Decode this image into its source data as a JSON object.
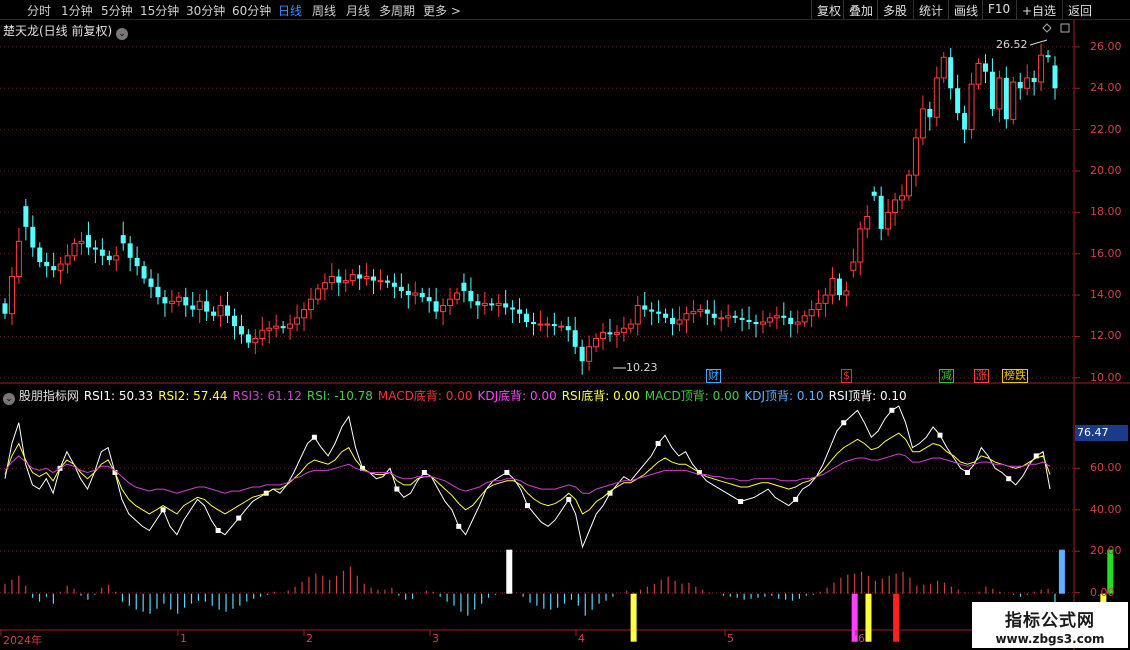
{
  "periods": [
    {
      "label": "分时",
      "active": false
    },
    {
      "label": "1分钟",
      "active": false
    },
    {
      "label": "5分钟",
      "active": false
    },
    {
      "label": "15分钟",
      "active": false
    },
    {
      "label": "30分钟",
      "active": false
    },
    {
      "label": "60分钟",
      "active": false
    },
    {
      "label": "日线",
      "active": true
    },
    {
      "label": "周线",
      "active": false
    },
    {
      "label": "月线",
      "active": false
    },
    {
      "label": "多周期",
      "active": false
    },
    {
      "label": "更多 >",
      "active": false
    }
  ],
  "toolbar_right": [
    "复权",
    "叠加",
    "多股",
    "统计",
    "画线",
    "F10",
    "+自选",
    "返回"
  ],
  "stock_title": "楚天龙(日线 前复权)",
  "price_high_label": "26.52",
  "price_low_label": "10.23",
  "events": [
    {
      "label": "财",
      "color": "#4aa8ff",
      "bg": "#000"
    },
    {
      "label": "$",
      "color": "#e03030",
      "bg": "#000"
    },
    {
      "label": "减",
      "color": "#30c030",
      "bg": "#000"
    },
    {
      "label": "涨",
      "color": "#ff4040",
      "bg": "#000"
    },
    {
      "label": "榜跌",
      "color": "#f0c800",
      "bg": "#000"
    }
  ],
  "indicator": {
    "name": "股朋指标网",
    "items": [
      {
        "label": "RSI1: 50.33",
        "color": "#ffffff"
      },
      {
        "label": "RSI2: 57.44",
        "color": "#ffff40"
      },
      {
        "label": "RSI3: 61.12",
        "color": "#d040d0"
      },
      {
        "label": "RSI: -10.78",
        "color": "#40d040"
      },
      {
        "label": "MACD底背: 0.00",
        "color": "#ff3030"
      },
      {
        "label": "KDJ底背: 0.00",
        "color": "#ff40ff"
      },
      {
        "label": "RSI底背: 0.00",
        "color": "#ffff40"
      },
      {
        "label": "MACD顶背: 0.00",
        "color": "#40d040"
      },
      {
        "label": "KDJ顶背: 0.10",
        "color": "#60b0ff"
      },
      {
        "label": "RSI顶背: 0.10",
        "color": "#ffffff"
      }
    ]
  },
  "current_rsi_tag": "76.47",
  "x_labels": [
    "2024年",
    "1",
    "2",
    "3",
    "4",
    "5",
    "6"
  ],
  "watermark": {
    "title": "指标公式网",
    "url": "www.zbgs3.com"
  },
  "chart_data": [
    {
      "type": "candlestick",
      "title": "楚天龙(日线 前复权)",
      "yticks": [
        10.0,
        12.0,
        14.0,
        16.0,
        18.0,
        20.0,
        22.0,
        24.0,
        26.0
      ],
      "ylim": [
        9.75,
        27.3
      ],
      "annotations": [
        {
          "text": "26.52",
          "type": "high"
        },
        {
          "text": "10.23",
          "type": "low"
        }
      ],
      "closes": [
        13.1,
        14.9,
        16.6,
        17.3,
        16.3,
        15.6,
        15.4,
        15.2,
        15.5,
        15.9,
        16.5,
        16.6,
        16.3,
        16.2,
        15.9,
        15.7,
        15.9,
        16.5,
        15.8,
        15.4,
        14.8,
        14.4,
        13.9,
        13.6,
        13.7,
        13.9,
        13.5,
        13.3,
        13.7,
        13.2,
        13.0,
        13.5,
        13.0,
        12.5,
        12.1,
        11.7,
        11.9,
        12.3,
        12.4,
        12.5,
        12.4,
        12.6,
        12.9,
        13.3,
        13.8,
        14.3,
        14.6,
        14.9,
        14.6,
        14.7,
        15.0,
        14.8,
        14.9,
        14.7,
        14.7,
        14.6,
        14.4,
        14.2,
        14.0,
        14.1,
        13.9,
        13.7,
        13.2,
        13.5,
        13.8,
        14.1,
        14.2,
        13.7,
        13.5,
        13.6,
        13.5,
        13.6,
        13.4,
        13.3,
        13.1,
        12.7,
        12.6,
        12.6,
        12.6,
        12.5,
        12.5,
        12.3,
        11.5,
        10.8,
        11.5,
        11.9,
        12.2,
        12.1,
        12.2,
        12.4,
        12.6,
        13.5,
        13.3,
        13.2,
        13.1,
        12.9,
        12.6,
        12.8,
        13.1,
        13.2,
        13.3,
        13.1,
        12.9,
        12.9,
        13.0,
        12.9,
        12.8,
        12.7,
        12.6,
        12.7,
        12.9,
        13.0,
        12.9,
        12.6,
        12.7,
        13.0,
        13.3,
        13.6,
        14.0,
        14.8,
        14.0,
        14.2,
        15.6,
        17.2,
        17.8,
        18.8,
        17.2,
        18.0,
        18.6,
        18.8,
        19.8,
        21.6,
        23.0,
        22.6,
        24.5,
        25.5,
        24.0,
        22.8,
        22.0,
        24.2,
        25.2,
        24.8,
        23.0,
        24.5,
        22.5,
        24.3,
        24.0,
        24.5,
        24.3,
        25.6,
        25.5,
        24.0
      ],
      "opens": [
        13.6,
        13.1,
        14.9,
        18.3,
        17.3,
        16.3,
        15.6,
        15.4,
        15.2,
        15.5,
        15.9,
        16.5,
        16.9,
        16.3,
        16.2,
        15.9,
        15.7,
        16.9,
        16.5,
        15.8,
        15.4,
        14.8,
        14.4,
        13.9,
        13.6,
        13.7,
        13.9,
        13.5,
        13.3,
        13.7,
        13.2,
        13.0,
        13.5,
        13.0,
        12.5,
        12.1,
        11.7,
        11.9,
        12.3,
        12.4,
        12.5,
        12.4,
        12.6,
        12.9,
        13.3,
        13.8,
        14.3,
        14.6,
        14.9,
        14.6,
        14.7,
        15.0,
        14.8,
        14.9,
        14.7,
        14.7,
        14.6,
        14.4,
        14.2,
        14.0,
        14.1,
        13.9,
        13.7,
        13.2,
        13.5,
        13.8,
        14.6,
        14.2,
        13.7,
        13.5,
        13.6,
        13.5,
        13.6,
        13.4,
        13.3,
        13.1,
        12.7,
        12.6,
        12.6,
        12.6,
        12.5,
        12.5,
        12.3,
        11.5,
        10.8,
        11.5,
        11.9,
        12.2,
        12.1,
        12.2,
        12.4,
        12.6,
        13.5,
        13.3,
        13.2,
        13.1,
        12.9,
        12.6,
        12.8,
        13.1,
        13.2,
        13.3,
        13.1,
        12.9,
        12.9,
        13.0,
        12.9,
        12.8,
        12.7,
        12.6,
        12.7,
        12.9,
        13.0,
        12.9,
        12.6,
        12.7,
        13.0,
        13.3,
        13.6,
        14.0,
        14.8,
        14.0,
        15.2,
        15.6,
        17.2,
        19.0,
        18.8,
        17.2,
        18.0,
        18.6,
        18.8,
        19.8,
        21.6,
        23.0,
        22.6,
        24.5,
        25.5,
        24.0,
        22.8,
        22.0,
        24.2,
        25.2,
        24.8,
        23.0,
        24.5,
        22.5,
        24.3,
        24.0,
        24.5,
        24.3,
        25.6,
        25.1
      ]
    },
    {
      "type": "line",
      "title": "股朋指标网",
      "yticks": [
        0.0,
        20.0,
        40.0,
        60.0
      ],
      "ylim": [
        -18,
        92
      ],
      "series": [
        {
          "name": "RSI1",
          "color": "#ffffff",
          "values": [
            55,
            72,
            82,
            62,
            52,
            50,
            55,
            48,
            60,
            68,
            62,
            55,
            50,
            58,
            68,
            70,
            58,
            45,
            38,
            35,
            32,
            30,
            35,
            40,
            32,
            28,
            35,
            40,
            45,
            42,
            35,
            30,
            28,
            32,
            36,
            40,
            44,
            46,
            48,
            50,
            48,
            52,
            58,
            65,
            72,
            75,
            70,
            66,
            72,
            80,
            85,
            70,
            60,
            58,
            55,
            56,
            60,
            50,
            46,
            48,
            54,
            58,
            56,
            50,
            44,
            40,
            32,
            28,
            35,
            42,
            50,
            54,
            56,
            58,
            55,
            50,
            42,
            38,
            34,
            32,
            35,
            40,
            45,
            38,
            22,
            30,
            38,
            42,
            48,
            52,
            56,
            54,
            58,
            62,
            66,
            72,
            76,
            70,
            66,
            68,
            62,
            58,
            54,
            52,
            50,
            48,
            46,
            44,
            45,
            46,
            48,
            50,
            46,
            44,
            42,
            45,
            50,
            52,
            56,
            62,
            70,
            78,
            82,
            85,
            88,
            82,
            75,
            78,
            84,
            88,
            90,
            82,
            70,
            72,
            75,
            80,
            76,
            70,
            65,
            60,
            58,
            62,
            70,
            66,
            60,
            58,
            55,
            52,
            56,
            62,
            66,
            68,
            50
          ],
          "markers": [
            8,
            16,
            23,
            31,
            34,
            38,
            45,
            52,
            57,
            61,
            66,
            73,
            76,
            82,
            88,
            95,
            101,
            107,
            115,
            122,
            129,
            136,
            140,
            146,
            150
          ]
        },
        {
          "name": "RSI2",
          "color": "#ffff40",
          "values": [
            57,
            66,
            72,
            64,
            58,
            56,
            58,
            54,
            60,
            64,
            62,
            58,
            55,
            58,
            62,
            64,
            58,
            50,
            45,
            42,
            40,
            38,
            40,
            42,
            40,
            38,
            42,
            44,
            46,
            45,
            42,
            40,
            38,
            40,
            42,
            44,
            46,
            47,
            48,
            50,
            50,
            52,
            55,
            58,
            62,
            64,
            63,
            62,
            64,
            68,
            70,
            64,
            60,
            58,
            57,
            57,
            58,
            54,
            52,
            52,
            55,
            56,
            56,
            53,
            50,
            47,
            43,
            40,
            42,
            46,
            50,
            52,
            53,
            54,
            54,
            52,
            48,
            45,
            43,
            42,
            43,
            45,
            48,
            45,
            38,
            40,
            44,
            46,
            49,
            51,
            53,
            53,
            55,
            57,
            60,
            63,
            65,
            63,
            62,
            62,
            60,
            58,
            56,
            55,
            54,
            53,
            52,
            51,
            51,
            52,
            53,
            53,
            52,
            51,
            50,
            51,
            53,
            54,
            56,
            59,
            63,
            67,
            70,
            72,
            74,
            72,
            69,
            70,
            73,
            75,
            77,
            74,
            68,
            68,
            70,
            72,
            71,
            68,
            66,
            63,
            62,
            63,
            66,
            65,
            63,
            62,
            61,
            60,
            61,
            63,
            65,
            66,
            57
          ],
          "markers": []
        },
        {
          "name": "RSI3",
          "color": "#d040d0",
          "values": [
            59,
            63,
            66,
            63,
            60,
            59,
            60,
            58,
            60,
            62,
            61,
            59,
            58,
            59,
            61,
            61,
            59,
            56,
            53,
            51,
            50,
            49,
            50,
            50,
            49,
            48,
            49,
            50,
            51,
            51,
            50,
            49,
            48,
            49,
            49,
            50,
            51,
            51,
            52,
            52,
            52,
            53,
            55,
            56,
            58,
            59,
            59,
            59,
            60,
            61,
            62,
            60,
            59,
            58,
            58,
            58,
            58,
            56,
            55,
            55,
            56,
            56,
            56,
            55,
            54,
            52,
            50,
            49,
            50,
            51,
            53,
            54,
            54,
            55,
            55,
            54,
            52,
            51,
            50,
            50,
            50,
            51,
            52,
            51,
            48,
            48,
            50,
            51,
            52,
            53,
            54,
            54,
            55,
            56,
            57,
            58,
            59,
            59,
            59,
            59,
            58,
            57,
            57,
            56,
            56,
            55,
            55,
            54,
            54,
            55,
            55,
            55,
            55,
            54,
            54,
            54,
            55,
            55,
            56,
            57,
            59,
            61,
            63,
            64,
            65,
            65,
            64,
            64,
            65,
            66,
            67,
            66,
            63,
            63,
            64,
            65,
            65,
            64,
            63,
            62,
            61,
            62,
            63,
            63,
            62,
            62,
            61,
            61,
            61,
            62,
            62,
            63,
            61
          ],
          "markers": []
        }
      ],
      "bars_note": "RSI histogram, positive red, negative cyan",
      "rsi_values": [
        10,
        14,
        18,
        8,
        -4,
        -8,
        -3,
        -10,
        2,
        8,
        5,
        -2,
        -6,
        -1,
        6,
        9,
        2,
        -8,
        -12,
        -16,
        -18,
        -20,
        -15,
        -10,
        -16,
        -20,
        -14,
        -10,
        -7,
        -8,
        -12,
        -16,
        -18,
        -15,
        -12,
        -8,
        -5,
        -3,
        -1,
        2,
        0,
        3,
        7,
        12,
        17,
        20,
        18,
        14,
        18,
        23,
        27,
        18,
        10,
        6,
        4,
        4,
        6,
        -2,
        -6,
        -5,
        0,
        3,
        2,
        -3,
        -8,
        -12,
        -18,
        -22,
        -16,
        -10,
        -4,
        -1,
        1,
        2,
        0,
        -3,
        -9,
        -12,
        -15,
        -16,
        -14,
        -10,
        -6,
        -12,
        -22,
        -16,
        -10,
        -7,
        -3,
        0,
        3,
        1,
        4,
        7,
        10,
        14,
        17,
        13,
        10,
        11,
        7,
        4,
        1,
        0,
        -2,
        -3,
        -4,
        -6,
        -5,
        -4,
        -3,
        -2,
        -5,
        -6,
        -7,
        -5,
        -2,
        -1,
        2,
        6,
        11,
        16,
        19,
        20,
        22,
        18,
        13,
        15,
        18,
        20,
        22,
        16,
        8,
        9,
        10,
        13,
        11,
        7,
        4,
        1,
        0,
        2,
        7,
        5,
        2,
        0,
        -1,
        -3,
        -1,
        2,
        4,
        5,
        -10
      ],
      "signals": [
        {
          "idx": 73,
          "color": "#ffffff",
          "dir": "up"
        },
        {
          "idx": 91,
          "color": "#ffff40",
          "dir": "down"
        },
        {
          "idx": 123,
          "color": "#ff40ff",
          "dir": "down"
        },
        {
          "idx": 125,
          "color": "#ffff40",
          "dir": "down"
        },
        {
          "idx": 129,
          "color": "#ff2020",
          "dir": "down"
        },
        {
          "idx": 153,
          "color": "#60b0ff",
          "dir": "up"
        },
        {
          "idx": 160,
          "color": "#20e020",
          "dir": "up"
        },
        {
          "idx": 159,
          "color": "#ffff40",
          "dir": "down"
        }
      ]
    }
  ]
}
